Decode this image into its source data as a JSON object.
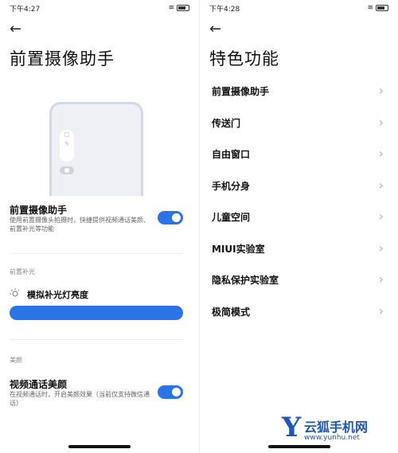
{
  "left": {
    "status_time": "下午4:27",
    "title": "前置摄像助手",
    "assistant": {
      "title": "前置摄像助手",
      "description": "使用前置摄像头拍摄时，快捷提供视频通话美颜、前置补光等功能",
      "enabled": true
    },
    "section_fill_light": "前置补光",
    "fill_light_label": "模拟补光灯亮度",
    "section_beauty": "美颜",
    "beauty": {
      "title": "视频通话美颜",
      "description": "在视频通话时，开启美颜效果（当前仅支持微信通话）",
      "enabled": true
    }
  },
  "right": {
    "status_time": "下午4:28",
    "title": "特色功能",
    "items": [
      {
        "label": "前置摄像助手"
      },
      {
        "label": "传送门"
      },
      {
        "label": "自由窗口"
      },
      {
        "label": "手机分身"
      },
      {
        "label": "儿童空间"
      },
      {
        "label": "MIUI实验室"
      },
      {
        "label": "隐私保护实验室"
      },
      {
        "label": "极简模式"
      }
    ]
  },
  "watermark": {
    "logo_letter": "Y",
    "name": "云狐手机网",
    "url": "www.yunhu.net"
  },
  "colors": {
    "accent": "#2b74e6",
    "watermark": "#1e58b4"
  },
  "icons": [
    "back-arrow-icon",
    "chevron-right-icon",
    "bulb-icon",
    "battery-icon",
    "wifi-icon"
  ]
}
